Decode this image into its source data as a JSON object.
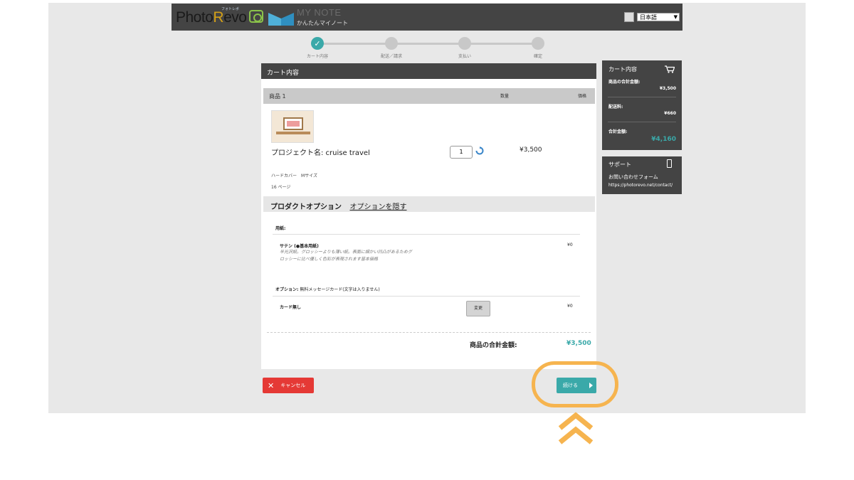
{
  "header": {
    "logo_photo": "Photo",
    "logo_r": "R",
    "logo_evo": "evo",
    "logo_small": "フォトレボ",
    "mynote_title": "MY NOTE",
    "mynote_sub": "かんたんマイノート",
    "language": "日本語"
  },
  "steps": [
    {
      "label": "カート内容",
      "done": true
    },
    {
      "label": "配送／請求",
      "done": false
    },
    {
      "label": "支払い",
      "done": false
    },
    {
      "label": "確定",
      "done": false
    }
  ],
  "cart": {
    "title": "カート内容",
    "col_item": "商品 1",
    "col_qty": "数量",
    "col_price": "価格",
    "project_name": "プロジェクト名: cruise travel",
    "quantity": "1",
    "price": "¥3,500",
    "cover": "ハードカバー　Mサイズ",
    "pages": "16 ページ",
    "options_title": "プロダクトオプション",
    "options_hide": "オプションを隠す",
    "paper_label": "用紙:",
    "satin_name": "サテン (●基本用紙)",
    "satin_desc": "半光沢紙。グロッシーよりも薄い紙。表面に細かい凹凸があるためグロッシーに比べ優しく色彩が表現されます基本価格",
    "satin_price": "¥0",
    "option_label": "オプション:",
    "option_value": "無料メッセージカード(文字は入りません)",
    "nocard": "カード無し",
    "change": "変更",
    "nocard_price": "¥0",
    "subtotal_label": "商品の合計金額:",
    "subtotal_value": "¥3,500"
  },
  "summary": {
    "title": "カート内容",
    "items_label": "商品の合計金額:",
    "items_value": "¥3,500",
    "shipping_label": "配送料:",
    "shipping_value": "¥660",
    "total_label": "合計金額:",
    "total_value": "¥4,160"
  },
  "support": {
    "title": "サポート",
    "contact_label": "お問い合わせフォーム",
    "contact_url": "https://photorevo.net/contact/"
  },
  "actions": {
    "cancel": "キャンセル",
    "continue": "続ける"
  },
  "colors": {
    "accent": "#3aa9a9",
    "cancel": "#e53935",
    "highlight": "#f6b44f",
    "dark": "#444444"
  }
}
